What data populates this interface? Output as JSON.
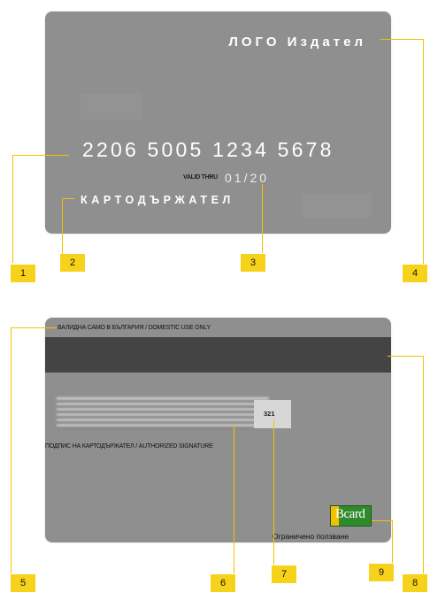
{
  "front": {
    "issuer_logo": "ЛОГО Издател",
    "card_number": "2206 5005 1234 5678",
    "valid_thru_label": "VALID THRU",
    "valid_thru_value": "01/20",
    "cardholder_name": "КАРТОДЪРЖАТЕЛ"
  },
  "back": {
    "domestic_note": "ВАЛИДНА САМО В БЪЛГАРИЯ / DOMESTIC USE ONLY",
    "cvv": "321",
    "signature_caption": "ПОДПИС НА КАРТОДЪРЖАТЕЛ / AUTHORIZED SIGNATURE",
    "logo_text": "Bcard",
    "restricted_note": "Ограничено ползване"
  },
  "callouts": [
    "1",
    "2",
    "3",
    "4",
    "5",
    "6",
    "7",
    "8",
    "9"
  ],
  "colors": {
    "card": "#8f8f8f",
    "magstripe": "#444444",
    "callout": "#f7d21a",
    "logo_green": "#2e8a2a",
    "logo_yellow": "#f2c200"
  }
}
